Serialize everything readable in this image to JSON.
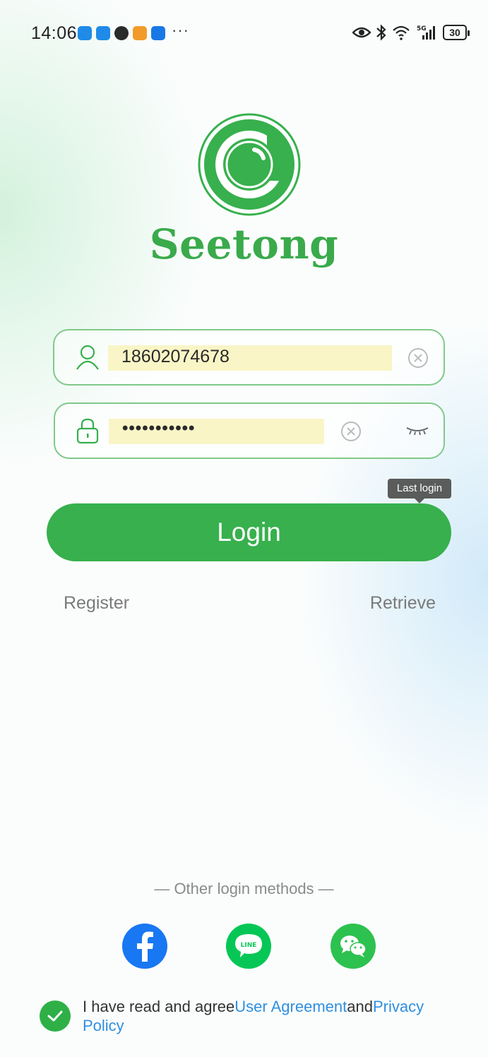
{
  "status_bar": {
    "time": "14:06",
    "more": "···",
    "battery": "30",
    "network": "5G"
  },
  "app": {
    "name": "Seetong",
    "accent_color": "#37b04d"
  },
  "form": {
    "username_value": "18602074678",
    "password_value": "•••••••••••",
    "last_login_tooltip": "Last login",
    "login_label": "Login",
    "register_label": "Register",
    "retrieve_label": "Retrieve"
  },
  "other_login": {
    "title": "— Other login methods —",
    "methods": [
      "facebook-icon",
      "line-icon",
      "wechat-icon"
    ],
    "line_text": "LINE"
  },
  "agreement": {
    "prefix": "I have read and agree",
    "user_agreement": "User Agreement",
    "and": "and",
    "privacy_policy": "Privacy Policy",
    "checked": true
  }
}
